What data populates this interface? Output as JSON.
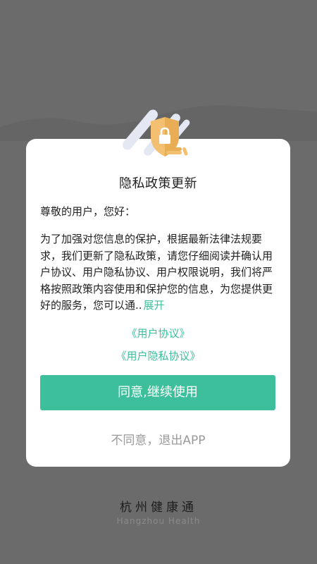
{
  "dialog": {
    "title": "隐私政策更新",
    "greeting": "尊敬的用户，您好：",
    "body": "为了加强对您信息的保护，根据最新法律法规要求，我们更新了隐私政策，请您仔细阅读并确认用户协议、用户隐私协议、用户权限说明，我们将严格按照政策内容使用和保护您的信息，为您提供更好的服务，您可以通..",
    "expand_label": "展开",
    "links": {
      "user_agreement": "《用户协议》",
      "privacy_agreement": "《用户隐私协议》"
    },
    "agree_button": "同意,继续使用",
    "disagree_button": "不同意，退出APP"
  },
  "brand": {
    "name_cn": "杭州健康通",
    "name_en": "Hangzhou Health"
  },
  "colors": {
    "accent": "#3dbf9c",
    "overlay": "#6b6b6b",
    "muted_text": "#9a9a9a"
  },
  "icons": {
    "header": "shield-lock-icon"
  }
}
